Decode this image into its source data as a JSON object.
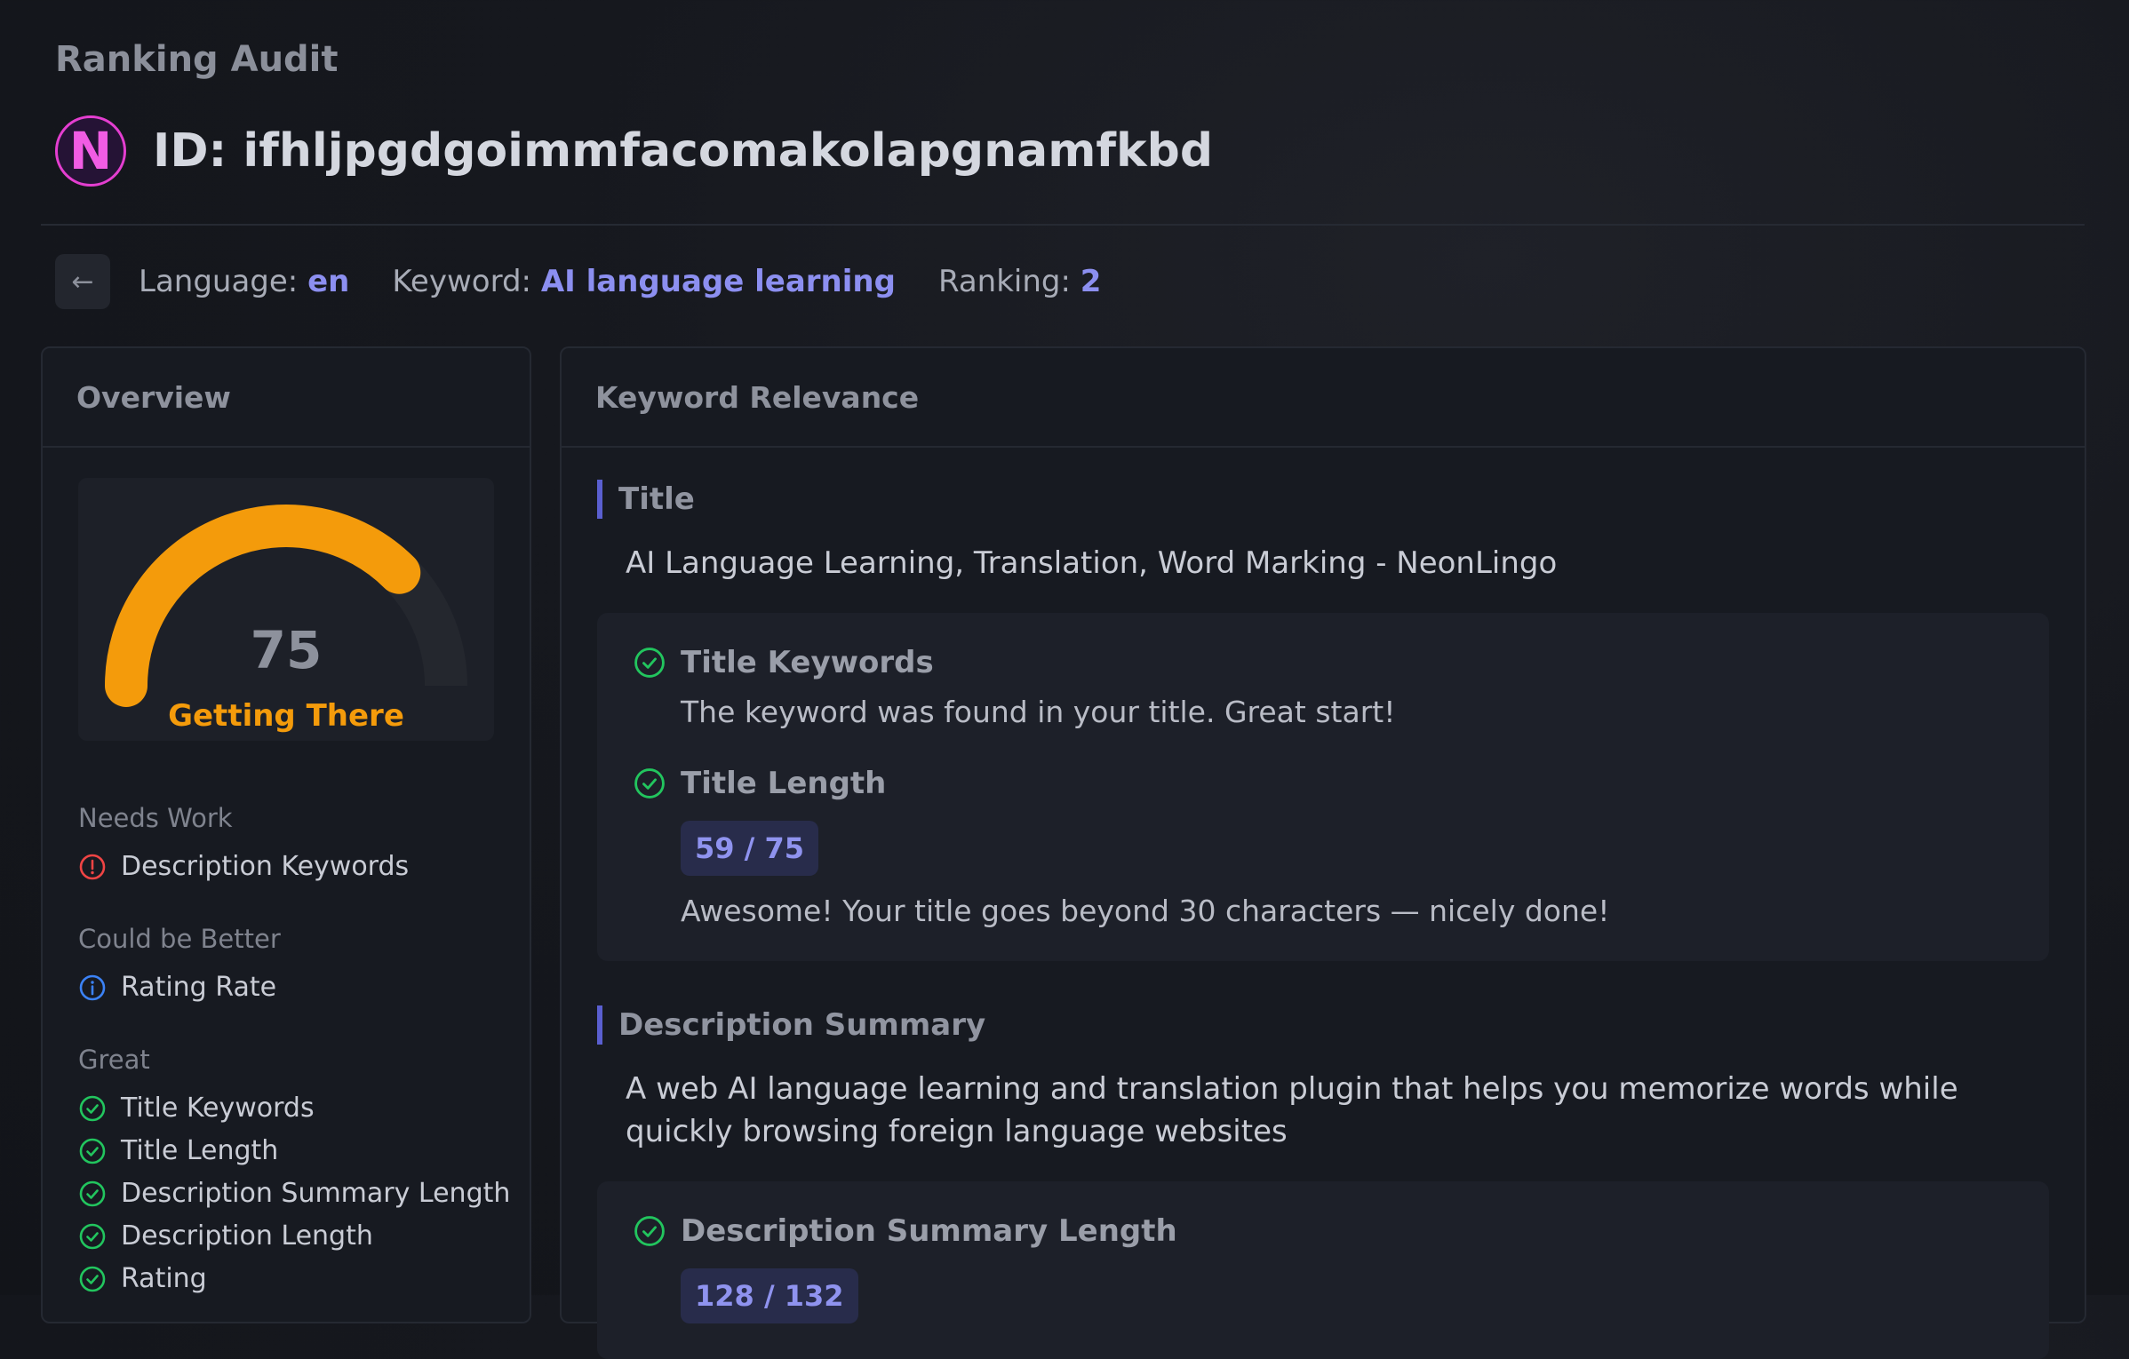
{
  "header": {
    "label": "Ranking Audit",
    "logo_letter": "N",
    "title": "ID: ifhljpgdgoimmfacomakolapgnamfkbd"
  },
  "meta": {
    "language_label": "Language:",
    "language_value": "en",
    "keyword_label": "Keyword:",
    "keyword_value": "AI language learning",
    "ranking_label": "Ranking:",
    "ranking_value": "2"
  },
  "overview": {
    "heading": "Overview",
    "score": "75",
    "score_fraction": 0.75,
    "status": "Getting There",
    "needs_work_title": "Needs Work",
    "needs_work": [
      "Description Keywords"
    ],
    "could_be_better_title": "Could be Better",
    "could_be_better": [
      "Rating Rate"
    ],
    "great_title": "Great",
    "great": [
      "Title Keywords",
      "Title Length",
      "Description Summary Length",
      "Description Length",
      "Rating"
    ]
  },
  "relevance": {
    "heading": "Keyword Relevance",
    "title_section": {
      "heading": "Title",
      "text": "AI Language Learning, Translation, Word Marking - NeonLingo",
      "check1_label": "Title Keywords",
      "check1_desc": "The keyword was found in your title. Great start!",
      "check2_label": "Title Length",
      "check2_count": "59 / 75",
      "check2_desc": "Awesome! Your title goes beyond 30 characters — nicely done!"
    },
    "summary_section": {
      "heading": "Description Summary",
      "text": "A web AI language learning and translation plugin that helps you memorize words while quickly browsing foreign language websites",
      "check1_label": "Description Summary Length",
      "check1_count": "128 / 132"
    }
  },
  "colors": {
    "accent": "#8c8ff0",
    "gauge": "#f49b0b",
    "success": "#22c55e",
    "warning": "#ef4444",
    "info": "#3b82f6"
  }
}
